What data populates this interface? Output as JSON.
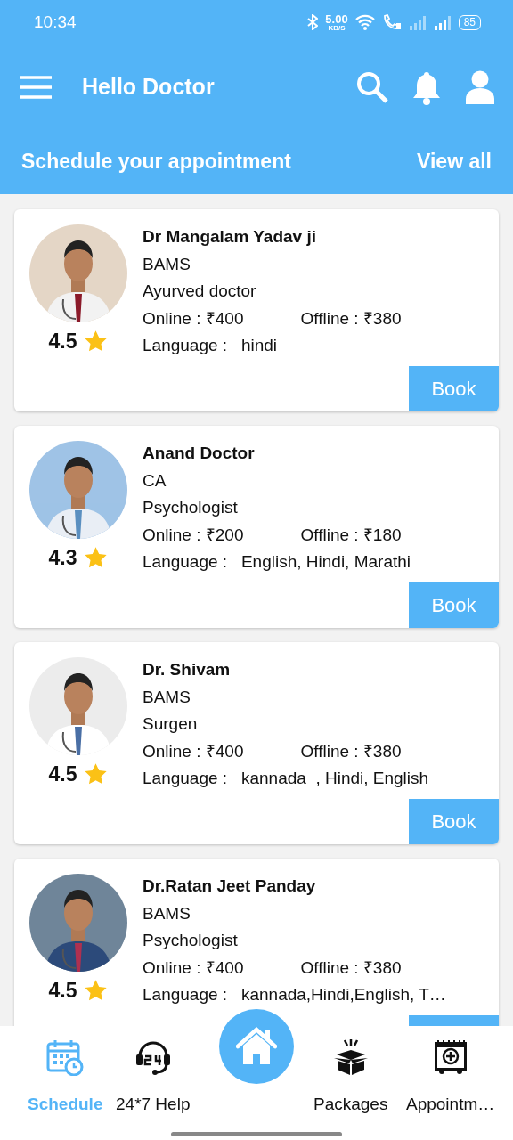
{
  "status_bar": {
    "time": "10:34",
    "speed": "5.00",
    "speed_unit": "KB/S",
    "battery": "85"
  },
  "header": {
    "title": "Hello Doctor"
  },
  "section": {
    "title": "Schedule your appointment",
    "link": "View all"
  },
  "doctors": [
    {
      "name": "Dr Mangalam Yadav ji",
      "degree": "BAMS",
      "specialty": "Ayurved doctor",
      "online": "Online : ₹400",
      "offline": "Offline : ₹380",
      "language": "Language :   hindi",
      "rating": "4.5",
      "book": "Book"
    },
    {
      "name": "Anand Doctor",
      "degree": "CA",
      "specialty": "Psychologist",
      "online": "Online : ₹200",
      "offline": "Offline : ₹180",
      "language": "Language :   English, Hindi, Marathi",
      "rating": "4.3",
      "book": "Book"
    },
    {
      "name": "Dr. Shivam",
      "degree": "BAMS",
      "specialty": "Surgen",
      "online": "Online : ₹400",
      "offline": "Offline : ₹380",
      "language": "Language :   kannada  , Hindi, English",
      "rating": "4.5",
      "book": "Book"
    },
    {
      "name": "Dr.Ratan Jeet Panday",
      "degree": "BAMS",
      "specialty": "Psychologist",
      "online": "Online : ₹400",
      "offline": "Offline : ₹380",
      "language": "Language :   kannada,Hindi,English, T…",
      "rating": "4.5"
    }
  ],
  "bottom_nav": [
    {
      "kind": "schedule",
      "label": "Schedule",
      "selected": true
    },
    {
      "kind": "help",
      "label": "24*7 Help",
      "selected": false
    },
    {
      "kind": "home",
      "selected": false
    },
    {
      "kind": "packages",
      "label": "Packages",
      "selected": false
    },
    {
      "kind": "appointments",
      "label": "Appointm…",
      "selected": false
    }
  ]
}
